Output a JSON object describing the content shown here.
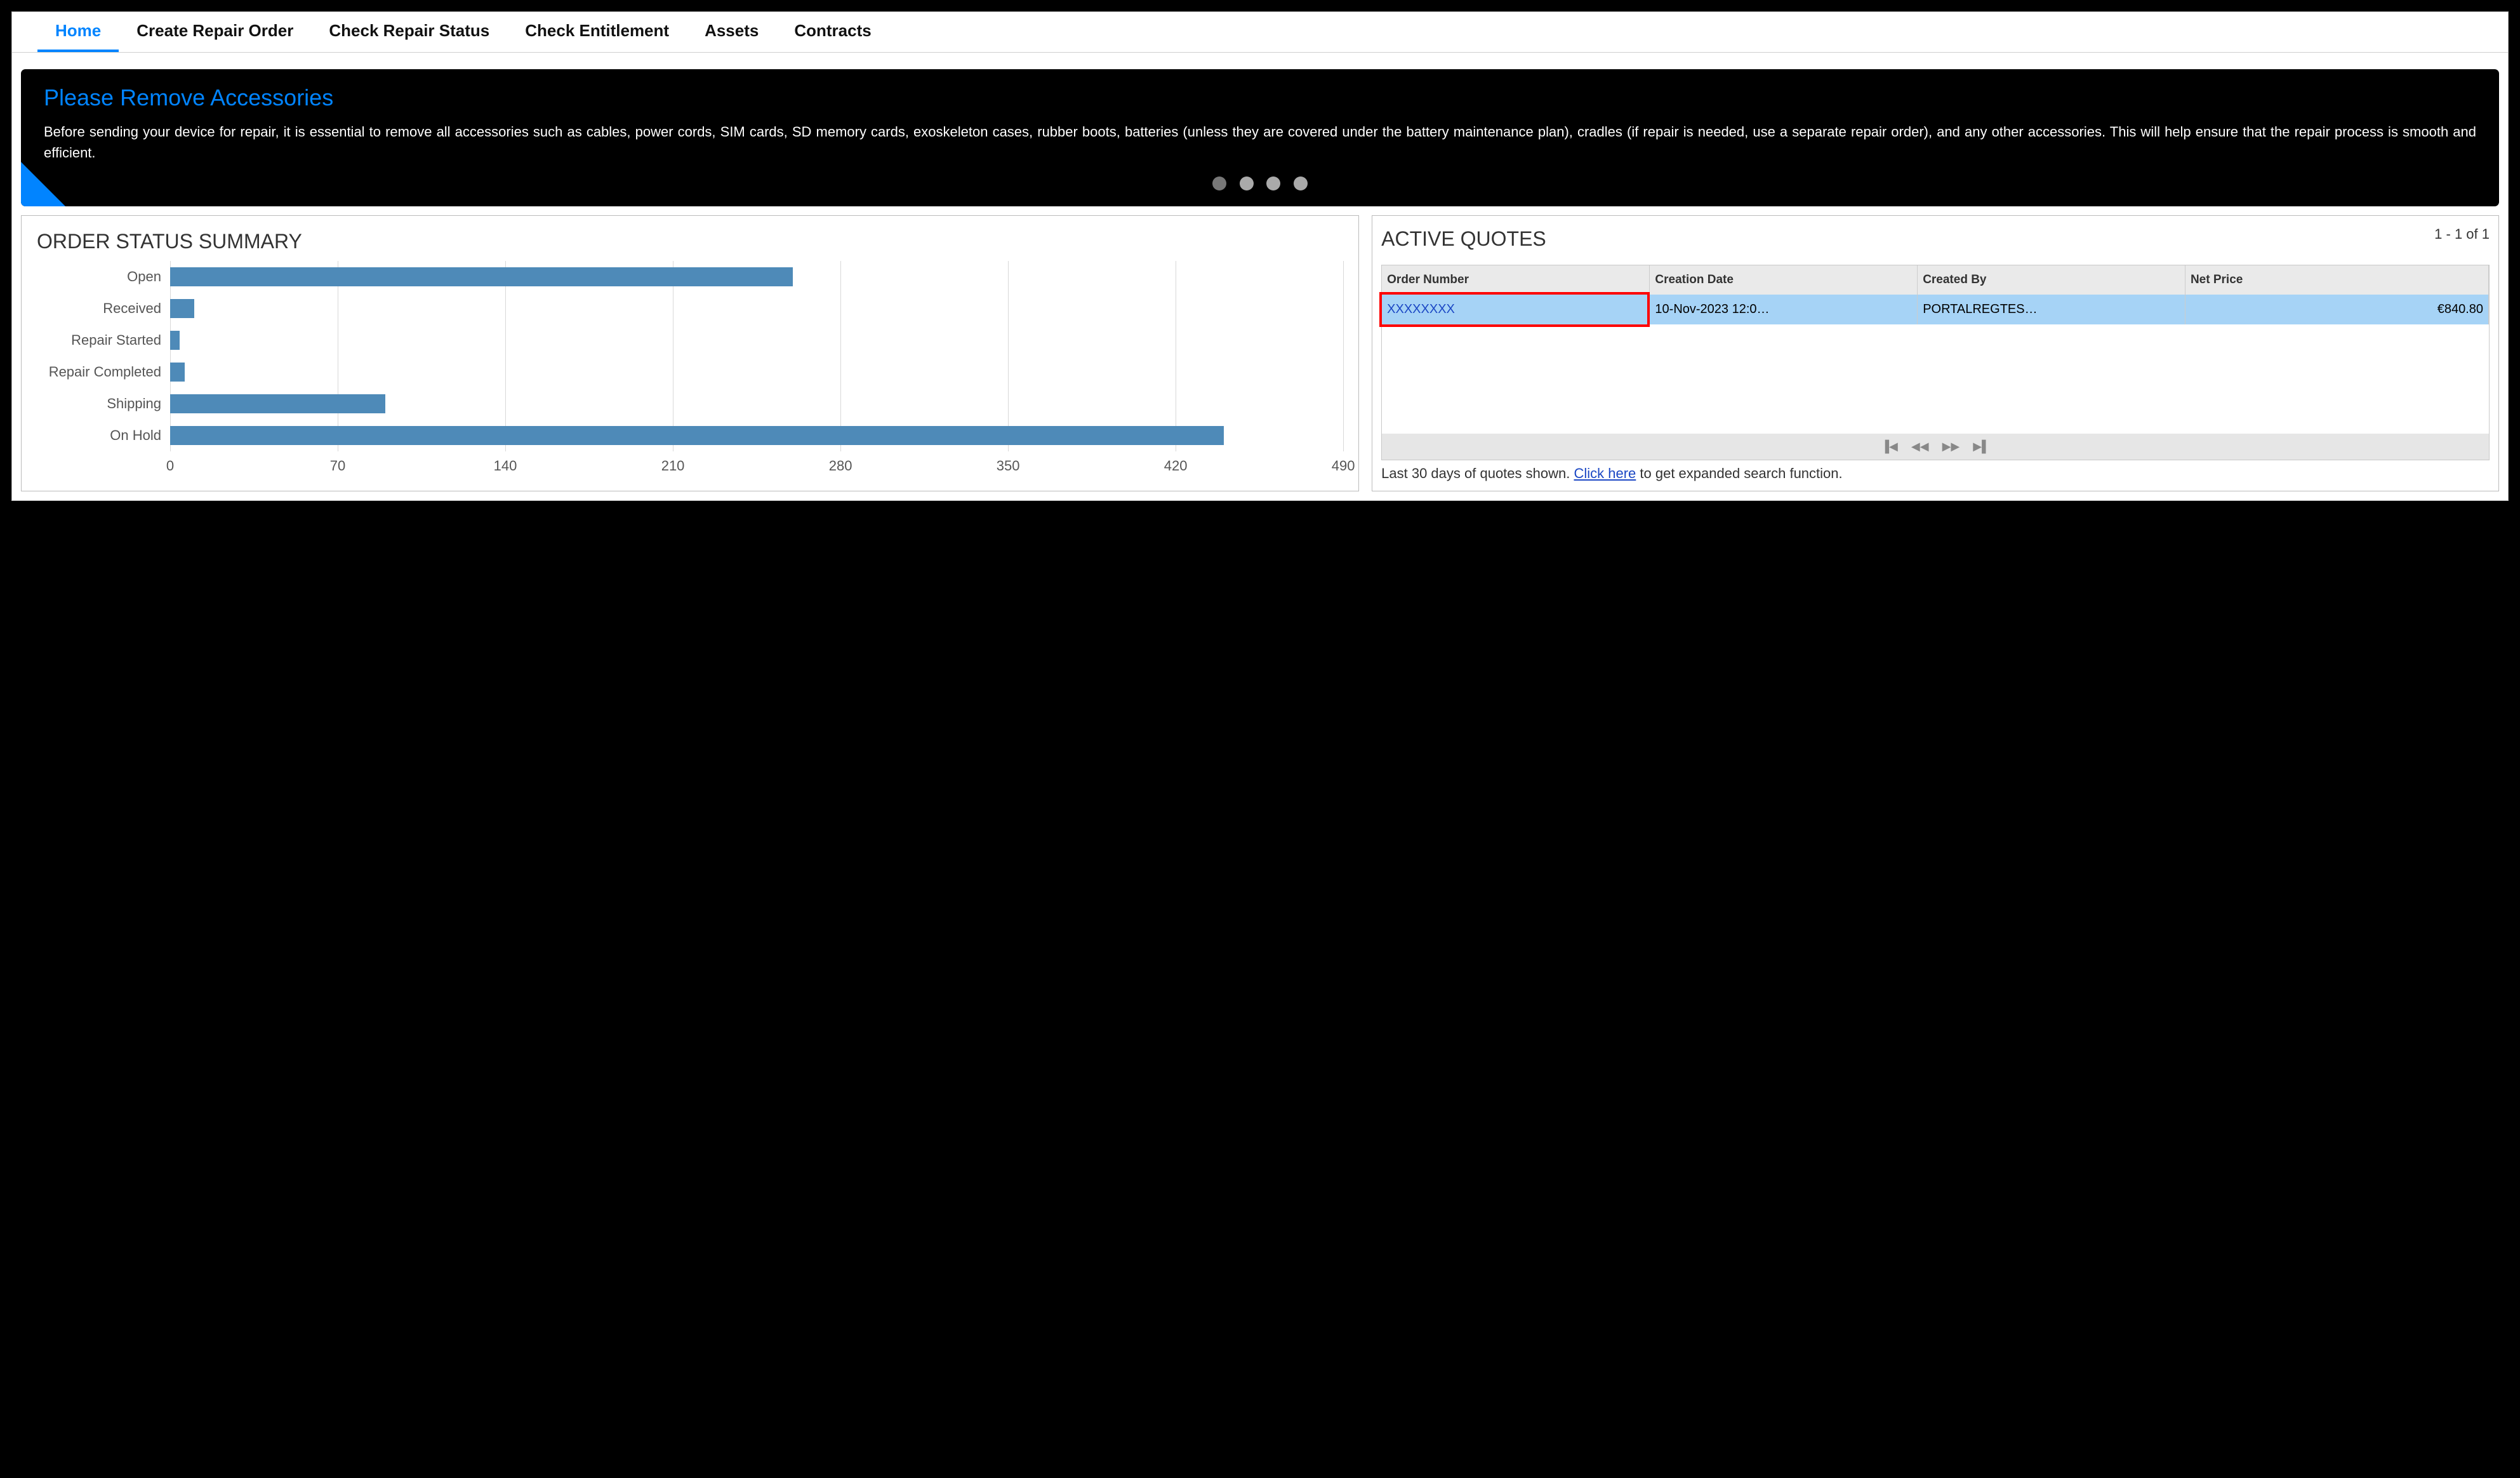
{
  "nav": {
    "items": [
      {
        "label": "Home",
        "active": true
      },
      {
        "label": "Create Repair Order"
      },
      {
        "label": "Check Repair Status"
      },
      {
        "label": "Check Entitlement"
      },
      {
        "label": "Assets"
      },
      {
        "label": "Contracts"
      }
    ]
  },
  "banner": {
    "title": "Please Remove Accessories",
    "body": "Before sending your device for repair, it is essential to remove all accessories such as cables, power cords, SIM cards, SD memory cards, exoskeleton cases, rubber boots, batteries (unless they are covered under the battery maintenance plan), cradles (if repair is needed, use a separate repair order), and any other accessories. This will help ensure that the repair process is smooth and efficient."
  },
  "order_summary": {
    "title": "ORDER STATUS SUMMARY"
  },
  "chart_data": {
    "type": "bar",
    "orientation": "horizontal",
    "xlabel": "",
    "ylabel": "",
    "xlim": [
      0,
      490
    ],
    "x_ticks": [
      0,
      70,
      140,
      210,
      280,
      350,
      420,
      490
    ],
    "categories": [
      "Open",
      "Received",
      "Repair Started",
      "Repair Completed",
      "Shipping",
      "On Hold"
    ],
    "values": [
      260,
      10,
      4,
      6,
      90,
      440
    ]
  },
  "quotes": {
    "title": "ACTIVE QUOTES",
    "range": "1 - 1 of 1",
    "columns": [
      "Order Number",
      "Creation Date",
      "Created By",
      "Net Price"
    ],
    "rows": [
      {
        "order_number": "XXXXXXXX",
        "creation_date": "10-Nov-2023 12:0…",
        "created_by": "PORTALREGTES…",
        "net_price": "€840.80"
      }
    ],
    "footnote_pre": "Last 30 days of quotes shown. ",
    "footnote_link": "Click here",
    "footnote_post": " to get expanded search function."
  }
}
